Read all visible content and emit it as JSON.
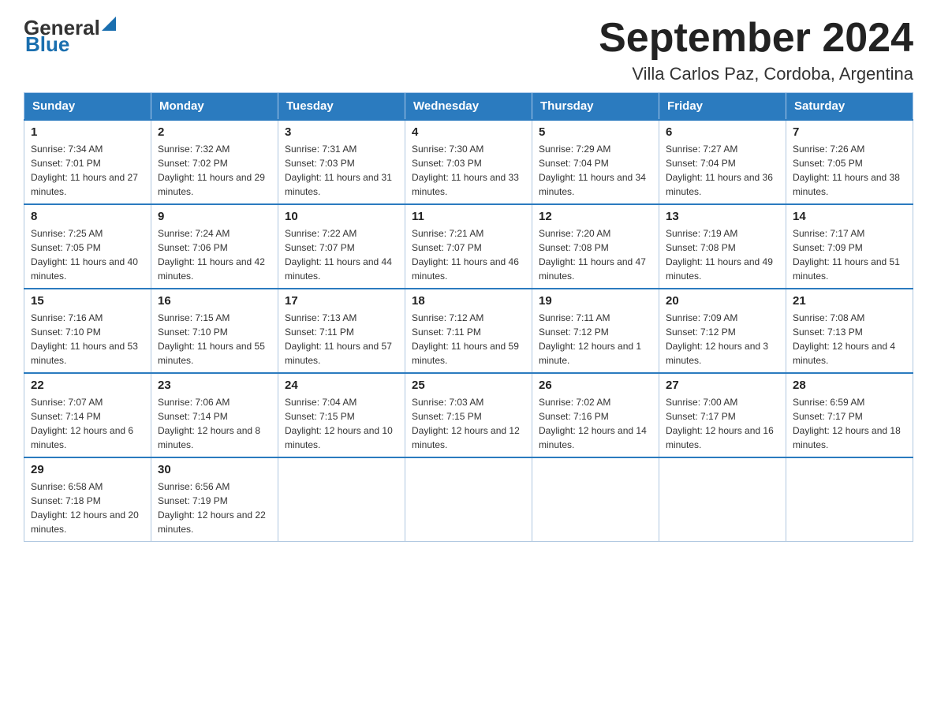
{
  "header": {
    "logo_general": "General",
    "logo_blue": "Blue",
    "month_title": "September 2024",
    "subtitle": "Villa Carlos Paz, Cordoba, Argentina"
  },
  "days_of_week": [
    "Sunday",
    "Monday",
    "Tuesday",
    "Wednesday",
    "Thursday",
    "Friday",
    "Saturday"
  ],
  "weeks": [
    [
      {
        "day": "1",
        "sunrise": "7:34 AM",
        "sunset": "7:01 PM",
        "daylight": "11 hours and 27 minutes."
      },
      {
        "day": "2",
        "sunrise": "7:32 AM",
        "sunset": "7:02 PM",
        "daylight": "11 hours and 29 minutes."
      },
      {
        "day": "3",
        "sunrise": "7:31 AM",
        "sunset": "7:03 PM",
        "daylight": "11 hours and 31 minutes."
      },
      {
        "day": "4",
        "sunrise": "7:30 AM",
        "sunset": "7:03 PM",
        "daylight": "11 hours and 33 minutes."
      },
      {
        "day": "5",
        "sunrise": "7:29 AM",
        "sunset": "7:04 PM",
        "daylight": "11 hours and 34 minutes."
      },
      {
        "day": "6",
        "sunrise": "7:27 AM",
        "sunset": "7:04 PM",
        "daylight": "11 hours and 36 minutes."
      },
      {
        "day": "7",
        "sunrise": "7:26 AM",
        "sunset": "7:05 PM",
        "daylight": "11 hours and 38 minutes."
      }
    ],
    [
      {
        "day": "8",
        "sunrise": "7:25 AM",
        "sunset": "7:05 PM",
        "daylight": "11 hours and 40 minutes."
      },
      {
        "day": "9",
        "sunrise": "7:24 AM",
        "sunset": "7:06 PM",
        "daylight": "11 hours and 42 minutes."
      },
      {
        "day": "10",
        "sunrise": "7:22 AM",
        "sunset": "7:07 PM",
        "daylight": "11 hours and 44 minutes."
      },
      {
        "day": "11",
        "sunrise": "7:21 AM",
        "sunset": "7:07 PM",
        "daylight": "11 hours and 46 minutes."
      },
      {
        "day": "12",
        "sunrise": "7:20 AM",
        "sunset": "7:08 PM",
        "daylight": "11 hours and 47 minutes."
      },
      {
        "day": "13",
        "sunrise": "7:19 AM",
        "sunset": "7:08 PM",
        "daylight": "11 hours and 49 minutes."
      },
      {
        "day": "14",
        "sunrise": "7:17 AM",
        "sunset": "7:09 PM",
        "daylight": "11 hours and 51 minutes."
      }
    ],
    [
      {
        "day": "15",
        "sunrise": "7:16 AM",
        "sunset": "7:10 PM",
        "daylight": "11 hours and 53 minutes."
      },
      {
        "day": "16",
        "sunrise": "7:15 AM",
        "sunset": "7:10 PM",
        "daylight": "11 hours and 55 minutes."
      },
      {
        "day": "17",
        "sunrise": "7:13 AM",
        "sunset": "7:11 PM",
        "daylight": "11 hours and 57 minutes."
      },
      {
        "day": "18",
        "sunrise": "7:12 AM",
        "sunset": "7:11 PM",
        "daylight": "11 hours and 59 minutes."
      },
      {
        "day": "19",
        "sunrise": "7:11 AM",
        "sunset": "7:12 PM",
        "daylight": "12 hours and 1 minute."
      },
      {
        "day": "20",
        "sunrise": "7:09 AM",
        "sunset": "7:12 PM",
        "daylight": "12 hours and 3 minutes."
      },
      {
        "day": "21",
        "sunrise": "7:08 AM",
        "sunset": "7:13 PM",
        "daylight": "12 hours and 4 minutes."
      }
    ],
    [
      {
        "day": "22",
        "sunrise": "7:07 AM",
        "sunset": "7:14 PM",
        "daylight": "12 hours and 6 minutes."
      },
      {
        "day": "23",
        "sunrise": "7:06 AM",
        "sunset": "7:14 PM",
        "daylight": "12 hours and 8 minutes."
      },
      {
        "day": "24",
        "sunrise": "7:04 AM",
        "sunset": "7:15 PM",
        "daylight": "12 hours and 10 minutes."
      },
      {
        "day": "25",
        "sunrise": "7:03 AM",
        "sunset": "7:15 PM",
        "daylight": "12 hours and 12 minutes."
      },
      {
        "day": "26",
        "sunrise": "7:02 AM",
        "sunset": "7:16 PM",
        "daylight": "12 hours and 14 minutes."
      },
      {
        "day": "27",
        "sunrise": "7:00 AM",
        "sunset": "7:17 PM",
        "daylight": "12 hours and 16 minutes."
      },
      {
        "day": "28",
        "sunrise": "6:59 AM",
        "sunset": "7:17 PM",
        "daylight": "12 hours and 18 minutes."
      }
    ],
    [
      {
        "day": "29",
        "sunrise": "6:58 AM",
        "sunset": "7:18 PM",
        "daylight": "12 hours and 20 minutes."
      },
      {
        "day": "30",
        "sunrise": "6:56 AM",
        "sunset": "7:19 PM",
        "daylight": "12 hours and 22 minutes."
      },
      null,
      null,
      null,
      null,
      null
    ]
  ],
  "labels": {
    "sunrise": "Sunrise:",
    "sunset": "Sunset:",
    "daylight": "Daylight:"
  }
}
